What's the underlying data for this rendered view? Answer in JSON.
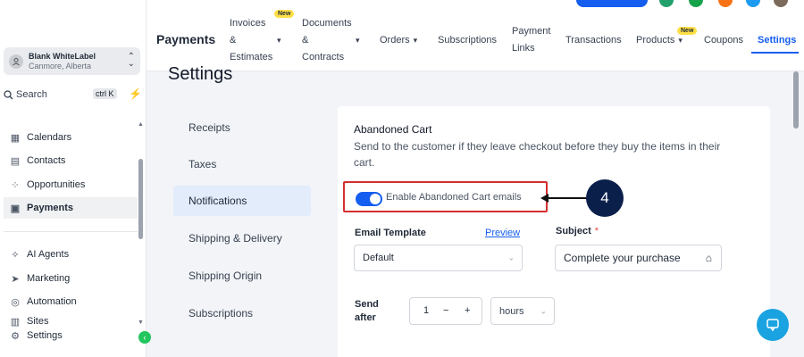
{
  "sidebar": {
    "account_name": "Blank WhiteLabel",
    "account_location": "Canmore, Alberta",
    "search_label": "Search",
    "search_shortcut": "ctrl K",
    "items": [
      {
        "label": "Calendars",
        "icon": "calendar-icon"
      },
      {
        "label": "Contacts",
        "icon": "contacts-icon"
      },
      {
        "label": "Opportunities",
        "icon": "opportunities-icon"
      },
      {
        "label": "Payments",
        "icon": "payments-icon",
        "active": true
      },
      {
        "label": "AI Agents",
        "icon": "ai-agents-icon"
      },
      {
        "label": "Marketing",
        "icon": "marketing-icon"
      },
      {
        "label": "Automation",
        "icon": "automation-icon"
      },
      {
        "label": "Sites",
        "icon": "sites-icon"
      },
      {
        "label": "Settings",
        "icon": "settings-icon"
      }
    ]
  },
  "header": {
    "title": "Payments",
    "tabs": [
      {
        "line1": "Invoices",
        "line2": "&",
        "line3": "Estimates",
        "dropdown": true,
        "badge": "New"
      },
      {
        "line1": "Documents",
        "line2": "&",
        "line3": "Contracts",
        "dropdown": true
      },
      {
        "label": "Orders",
        "dropdown": true
      },
      {
        "label": "Subscriptions"
      },
      {
        "line1": "Payment",
        "line2": "Links"
      },
      {
        "label": "Transactions"
      },
      {
        "label": "Products",
        "dropdown": true,
        "badge": "New"
      },
      {
        "label": "Coupons"
      },
      {
        "label": "Settings",
        "active": true
      }
    ]
  },
  "page": {
    "title": "Settings",
    "menu": [
      "Receipts",
      "Taxes",
      "Notifications",
      "Shipping & Delivery",
      "Shipping Origin",
      "Subscriptions"
    ],
    "active_menu": "Notifications"
  },
  "card": {
    "title": "Abandoned Cart",
    "description": "Send to the customer if they leave checkout before they buy the items in their cart.",
    "toggle_label": "Enable Abandoned Cart emails",
    "toggle_on": true,
    "email_template_label": "Email Template",
    "preview_label": "Preview",
    "template_value": "Default",
    "subject_label": "Subject",
    "subject_required": "*",
    "subject_value": "Complete your purchase",
    "send_after_label_1": "Send",
    "send_after_label_2": "after",
    "send_after_value": "1",
    "stepper_minus": "−",
    "stepper_plus": "+",
    "unit_value": "hours"
  },
  "annotation": {
    "step_number": "4"
  },
  "colors": {
    "accent": "#155eef",
    "highlight_border": "#d32f2f",
    "step_circle": "#0b1f4b",
    "chat_button": "#1aa3e0",
    "badge": "#fde047"
  }
}
